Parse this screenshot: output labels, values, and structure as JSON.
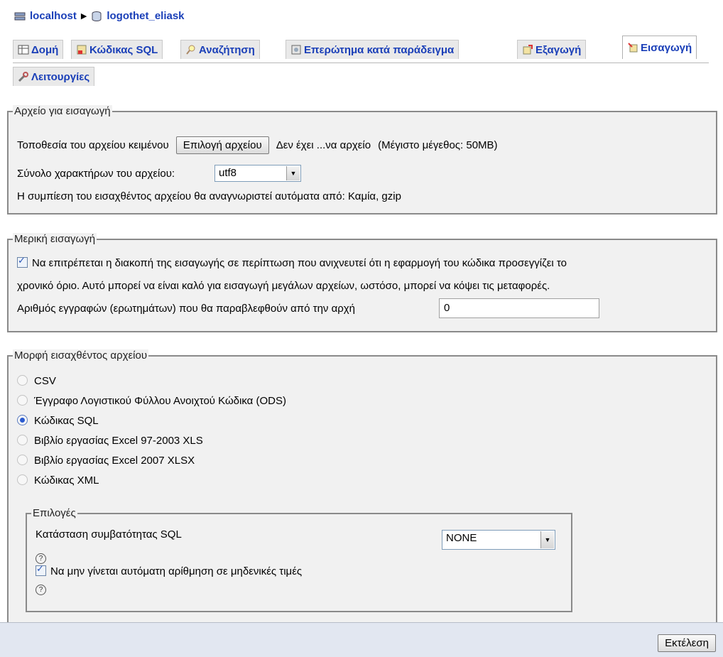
{
  "breadcrumb": {
    "server": "localhost",
    "database": "logothet_eliask"
  },
  "tabs": [
    "Δομή",
    "Κώδικας SQL",
    "Αναζήτηση",
    "Επερώτημα κατά παράδειγμα",
    "Εξαγωγή",
    "Εισαγωγή"
  ],
  "tabs_row2": [
    "Λειτουργίες"
  ],
  "file_section": {
    "legend": "Αρχείο για εισαγωγή",
    "location_label": "Τοποθεσία του αρχείου κειμένου",
    "browse_button": "Επιλογή αρχείου",
    "no_file_text": "Δεν έχει ...να αρχείο",
    "max_size": "(Μέγιστο μέγεθος: 50MB)",
    "charset_label": "Σύνολο χαρακτήρων του αρχείου:",
    "charset_value": "utf8",
    "compression_text": "Η συμπίεση του εισαχθέντος αρχείου θα αναγνωριστεί αυτόματα από: Καμία, gzip"
  },
  "partial_section": {
    "legend": "Μερική εισαγωγή",
    "allow_interrupt_line1": "Να επιτρέπεται η διακοπή της εισαγωγής σε περίπτωση που ανιχνευτεί ότι η εφαρμογή του κώδικα προσεγγίζει το",
    "allow_interrupt_line2": "χρονικό όριο. Αυτό μπορεί να είναι καλό για εισαγωγή μεγάλων αρχείων, ωστόσο, μπορεί να κόψει τις μεταφορές.",
    "skip_label": "Αριθμός εγγραφών (ερωτημάτων) που θα παραβλεφθούν από την αρχή",
    "skip_value": "0"
  },
  "format_section": {
    "legend": "Μορφή εισαχθέντος αρχείου",
    "formats": [
      "CSV",
      "Έγγραφο Λογιστικού Φύλλου Ανοιχτού Κώδικα (ODS)",
      "Κώδικας SQL",
      "Βιβλίο εργασίας Excel 97-2003 XLS",
      "Βιβλίο εργασίας Excel 2007 XLSX",
      "Κώδικας XML"
    ],
    "selected_index": 2
  },
  "options_section": {
    "legend": "Επιλογές",
    "compat_label": "Κατάσταση συμβατότητας SQL",
    "compat_value": "NONE",
    "help_glyph": "?",
    "no_auto_value_label": "Να μην γίνεται αυτόματη αρίθμηση σε μηδενικές τιμές"
  },
  "execute_button": "Εκτέλεση"
}
